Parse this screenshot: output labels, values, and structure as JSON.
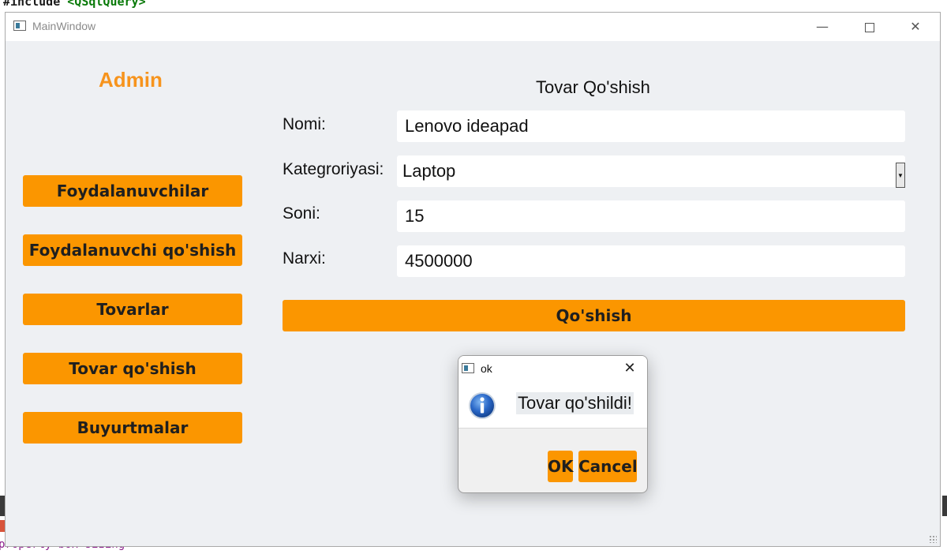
{
  "background": {
    "code_line_prefix": "#include ",
    "code_line_include": "<QSqlQuery>",
    "bottom_text": "property box-sizing"
  },
  "window": {
    "title": "MainWindow",
    "controls": {
      "minimize": "—",
      "close": "✕"
    }
  },
  "sidebar": {
    "role_label": "Admin",
    "items": [
      {
        "label": "Foydalanuvchilar"
      },
      {
        "label": "Foydalanuvchi qo'shish"
      },
      {
        "label": "Tovarlar"
      },
      {
        "label": "Tovar qo'shish"
      },
      {
        "label": "Buyurtmalar"
      }
    ]
  },
  "form": {
    "title": "Tovar Qo'shish",
    "fields": {
      "name": {
        "label": "Nomi:",
        "value": "Lenovo ideapad"
      },
      "category": {
        "label": "Kategroriyasi:",
        "value": "Laptop"
      },
      "quantity": {
        "label": "Soni:",
        "value": "15"
      },
      "price": {
        "label": "Narxi:",
        "value": "4500000"
      }
    },
    "submit_label": "Qo'shish"
  },
  "dialog": {
    "title": "ok",
    "message": "Tovar qo'shildi!",
    "ok_label": "OK",
    "cancel_label": "Cancel",
    "close_glyph": "✕"
  },
  "colors": {
    "accent": "#fb9600",
    "admin_label": "#f7941d",
    "window_bg": "#eef0f3"
  }
}
